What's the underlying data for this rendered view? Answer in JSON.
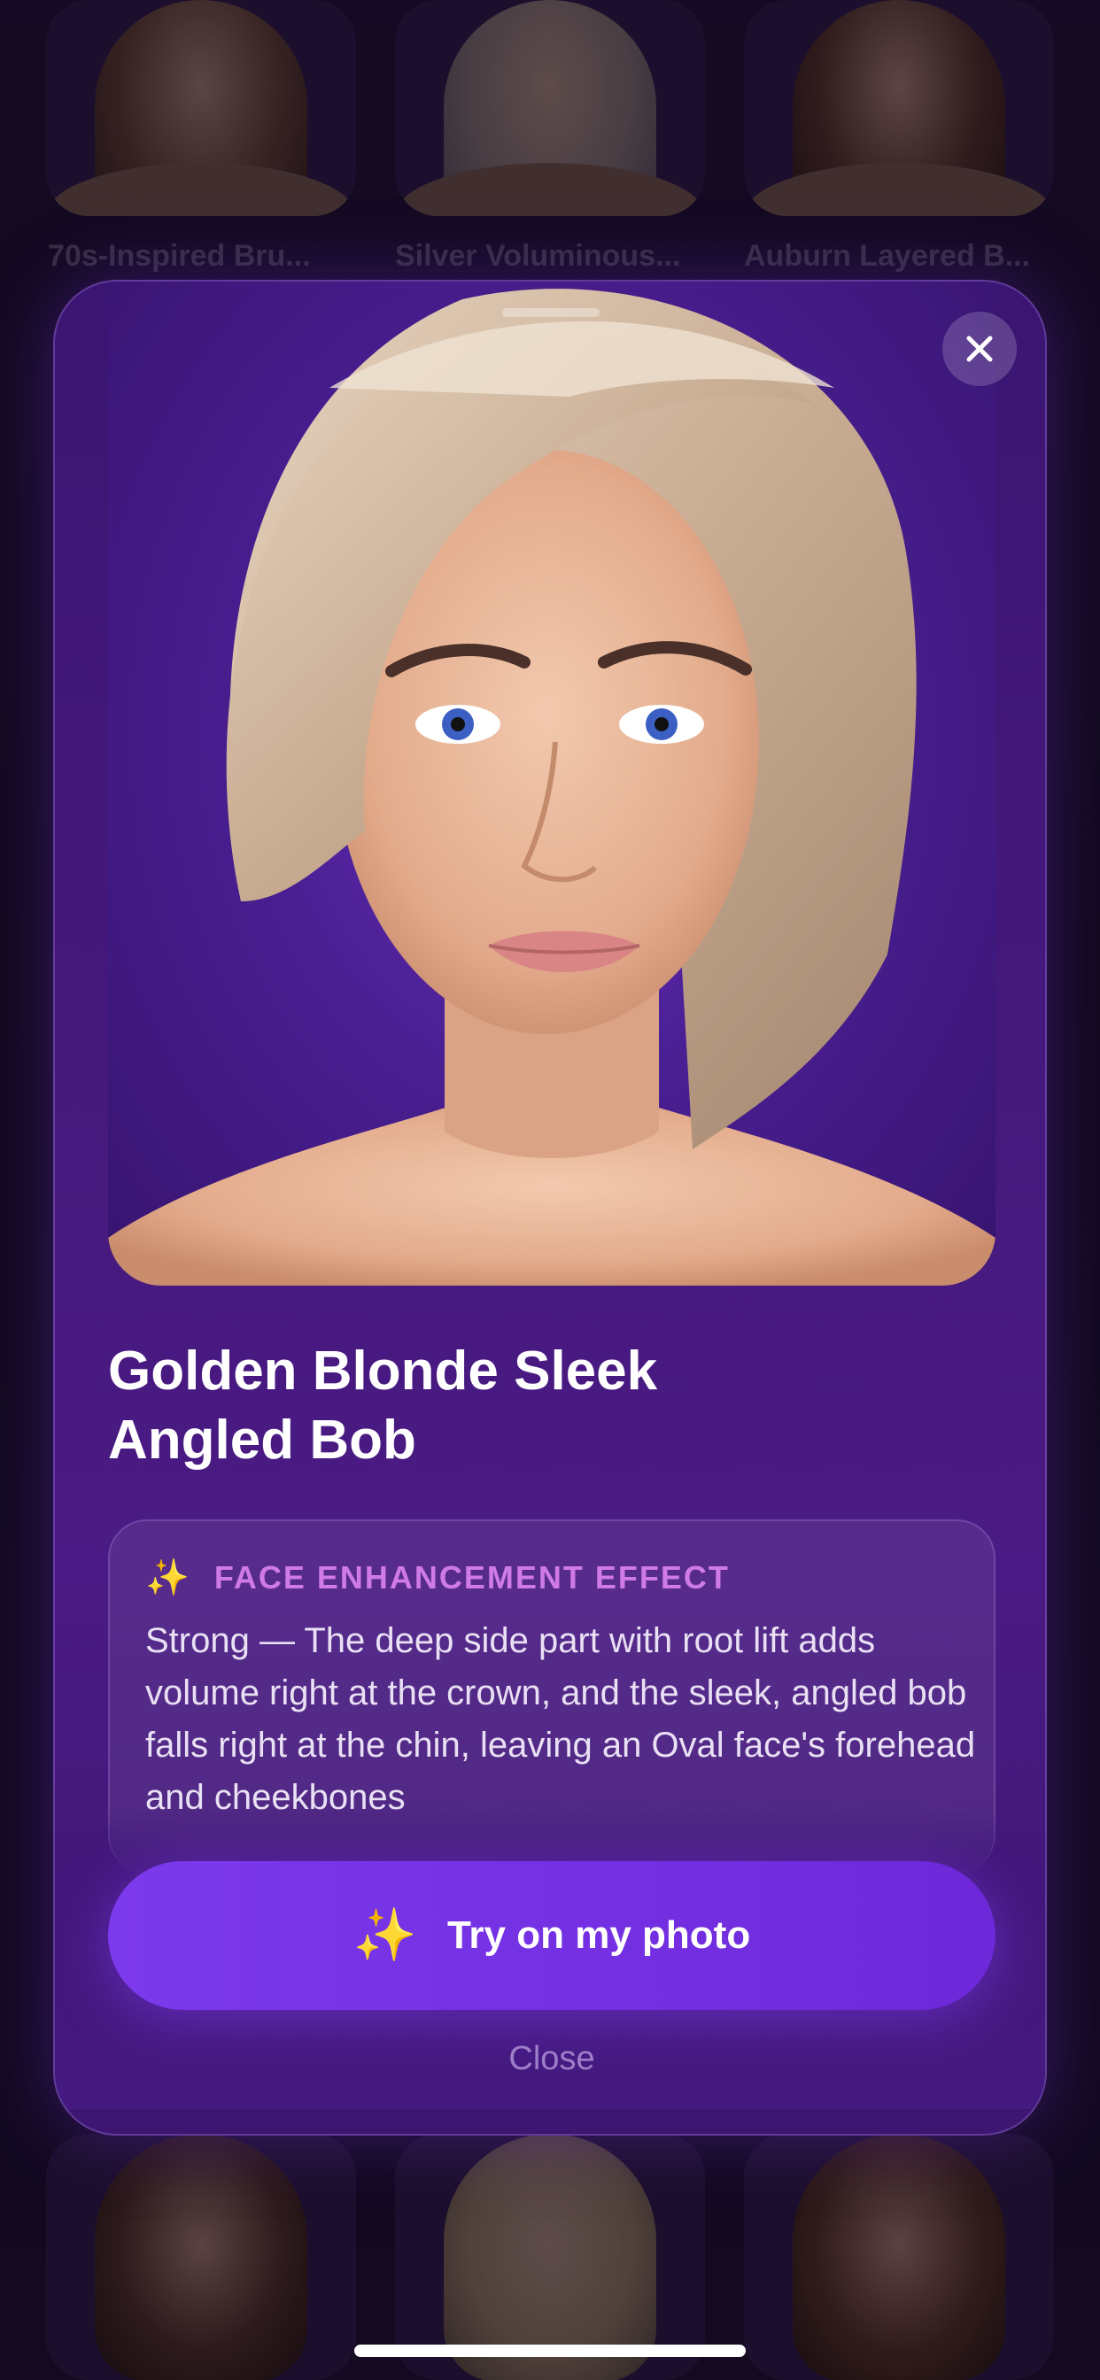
{
  "background": {
    "top_row_labels": [
      "70s-Inspired Bru...",
      "Silver Voluminous...",
      "Auburn Layered B..."
    ]
  },
  "modal": {
    "title_line1": "Golden Blonde Sleek",
    "title_line2": "Angled Bob",
    "effect": {
      "icon": "sparkles-icon",
      "label": "FACE ENHANCEMENT EFFECT",
      "text": "Strong — The deep side part with root lift adds volume right at the crown, and the sleek, angled bob falls right at the chin, leaving an Oval face's forehead and cheekbones"
    },
    "cta": {
      "icon": "sparkles-icon",
      "label": "Try on my photo"
    },
    "close_label": "Close"
  },
  "colors": {
    "accent": "#7c3aed",
    "effect_label": "#cf7ae6",
    "modal_bg": "#45197c"
  }
}
